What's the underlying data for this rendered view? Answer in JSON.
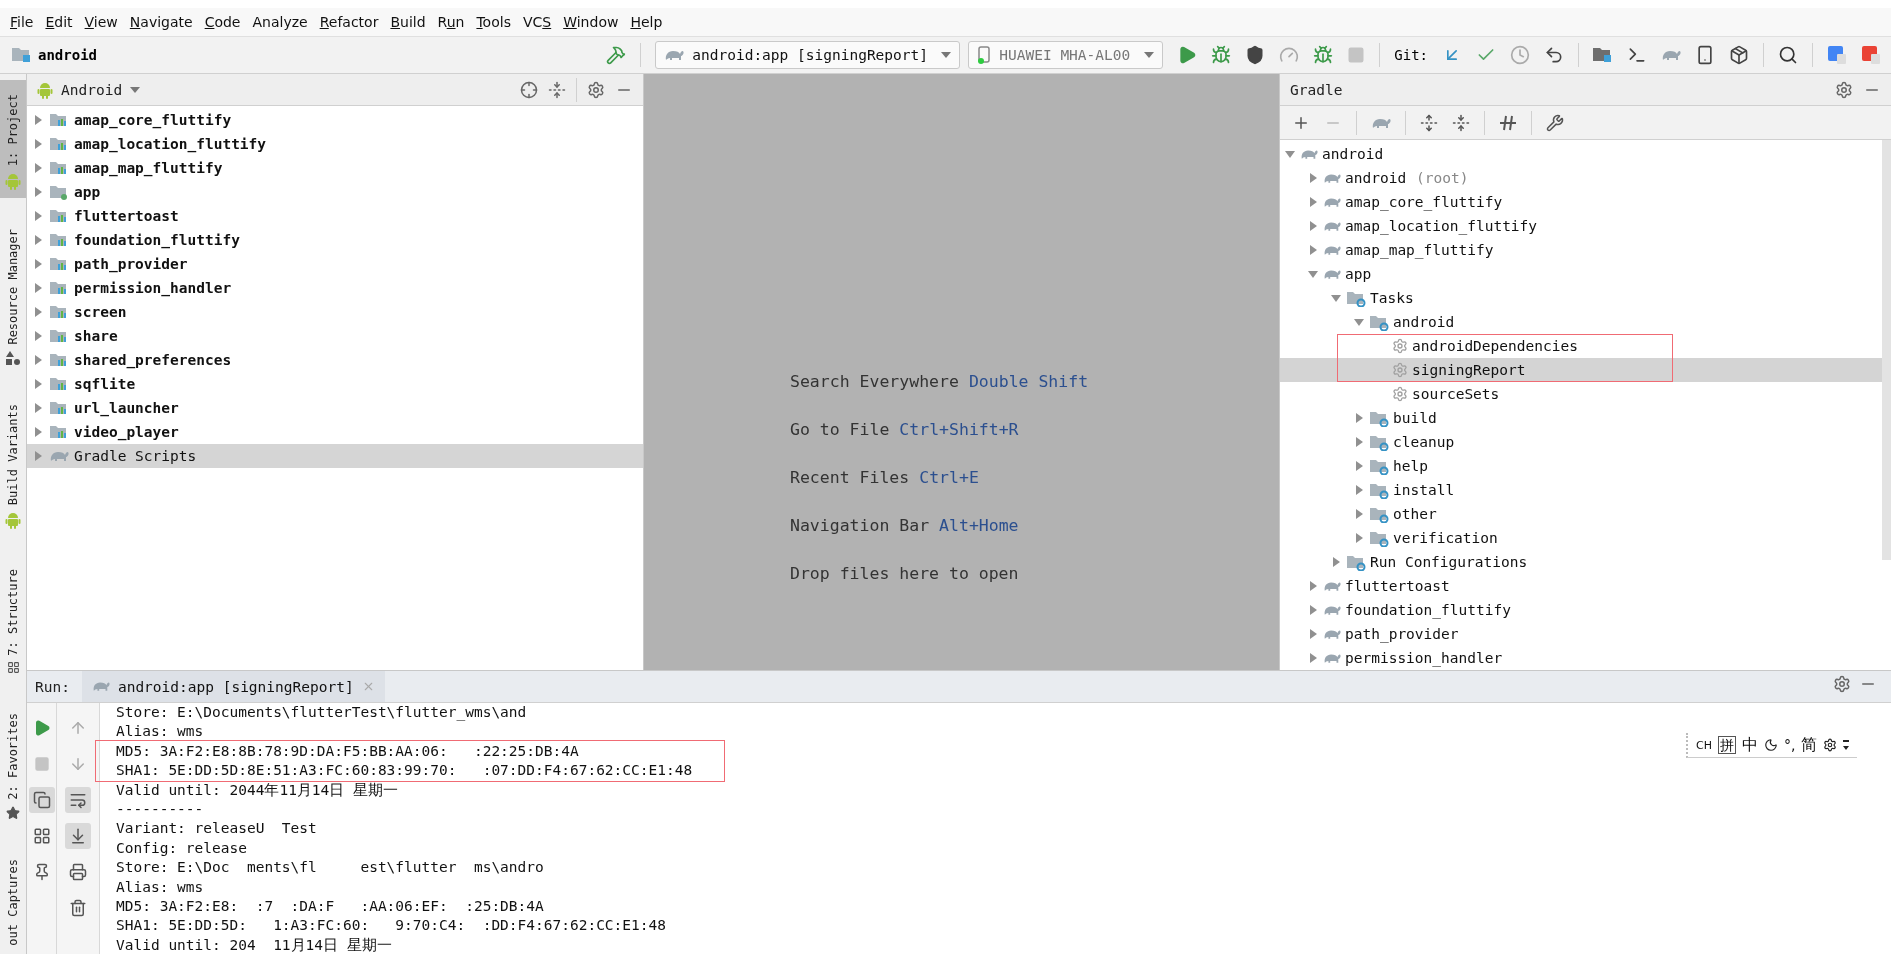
{
  "menu": [
    {
      "key": "F",
      "after": "ile"
    },
    {
      "key": "E",
      "after": "dit"
    },
    {
      "key": "V",
      "after": "iew"
    },
    {
      "key": "N",
      "after": "avigate"
    },
    {
      "key": "C",
      "after": "ode"
    },
    {
      "before": "Analyze"
    },
    {
      "key": "R",
      "after": "efactor"
    },
    {
      "key": "B",
      "after": "uild"
    },
    {
      "before": "R",
      "key": "u",
      "after": "n"
    },
    {
      "key": "T",
      "after": "ools"
    },
    {
      "before": "VC",
      "key": "S"
    },
    {
      "key": "W",
      "after": "indow"
    },
    {
      "key": "H",
      "after": "elp"
    }
  ],
  "toolbar": {
    "project": "android",
    "run_config": "android:app [signingReport]",
    "device": "HUAWEI MHA-AL00",
    "git_label": "Git:"
  },
  "tool_windows_left": [
    {
      "label": "1: Project",
      "selected": true,
      "kind": "android"
    },
    {
      "label": "Resource Manager",
      "selected": false,
      "kind": "shapes"
    },
    {
      "label": "Build Variants",
      "selected": false,
      "kind": "build"
    },
    {
      "label": "7: Structure",
      "selected": false,
      "kind": "structure"
    },
    {
      "label": "2: Favorites",
      "selected": false,
      "kind": "star"
    },
    {
      "label": "out Captures",
      "selected": false,
      "kind": "none"
    }
  ],
  "project_panel": {
    "view": "Android",
    "items": [
      {
        "label": "amap_core_fluttify",
        "kind": "module",
        "expanded": false,
        "selected": false
      },
      {
        "label": "amap_location_fluttify",
        "kind": "module",
        "expanded": false,
        "selected": false
      },
      {
        "label": "amap_map_fluttify",
        "kind": "module",
        "expanded": false,
        "selected": false
      },
      {
        "label": "app",
        "kind": "app",
        "expanded": false,
        "selected": false
      },
      {
        "label": "fluttertoast",
        "kind": "module",
        "expanded": false,
        "selected": false
      },
      {
        "label": "foundation_fluttify",
        "kind": "module",
        "expanded": false,
        "selected": false
      },
      {
        "label": "path_provider",
        "kind": "module",
        "expanded": false,
        "selected": false
      },
      {
        "label": "permission_handler",
        "kind": "module",
        "expanded": false,
        "selected": false
      },
      {
        "label": "screen",
        "kind": "module",
        "expanded": false,
        "selected": false
      },
      {
        "label": "share",
        "kind": "module",
        "expanded": false,
        "selected": false
      },
      {
        "label": "shared_preferences",
        "kind": "module",
        "expanded": false,
        "selected": false
      },
      {
        "label": "sqflite",
        "kind": "module",
        "expanded": false,
        "selected": false
      },
      {
        "label": "url_launcher",
        "kind": "module",
        "expanded": false,
        "selected": false
      },
      {
        "label": "video_player",
        "kind": "module",
        "expanded": false,
        "selected": false
      },
      {
        "label": "Gradle Scripts",
        "kind": "gradle",
        "expanded": false,
        "selected": true
      }
    ]
  },
  "editor_hints": [
    {
      "label": "Search Everywhere",
      "shortcut": "Double Shift"
    },
    {
      "label": "Go to File",
      "shortcut": "Ctrl+Shift+R"
    },
    {
      "label": "Recent Files",
      "shortcut": "Ctrl+E"
    },
    {
      "label": "Navigation Bar",
      "shortcut": "Alt+Home"
    },
    {
      "label": "Drop files here to open"
    }
  ],
  "gradle_panel": {
    "title": "Gradle",
    "tree": [
      {
        "label": "android",
        "kind": "project",
        "expanded": true,
        "selected": false,
        "children": [
          {
            "label": "android",
            "note": "(root)",
            "kind": "project",
            "expanded": false,
            "selected": false
          },
          {
            "label": "amap_core_fluttify",
            "kind": "project",
            "expanded": false,
            "selected": false
          },
          {
            "label": "amap_location_fluttify",
            "kind": "project",
            "expanded": false,
            "selected": false
          },
          {
            "label": "amap_map_fluttify",
            "kind": "project",
            "expanded": false,
            "selected": false
          },
          {
            "label": "app",
            "kind": "project",
            "expanded": true,
            "selected": false,
            "children": [
              {
                "label": "Tasks",
                "kind": "folder",
                "expanded": true,
                "selected": false,
                "children": [
                  {
                    "label": "android",
                    "kind": "folder",
                    "expanded": true,
                    "selected": false,
                    "children": [
                      {
                        "label": "androidDependencies",
                        "kind": "task",
                        "selected": false
                      },
                      {
                        "label": "signingReport",
                        "kind": "task",
                        "selected": true
                      },
                      {
                        "label": "sourceSets",
                        "kind": "task",
                        "selected": false
                      }
                    ]
                  },
                  {
                    "label": "build",
                    "kind": "folder",
                    "expanded": false,
                    "selected": false
                  },
                  {
                    "label": "cleanup",
                    "kind": "folder",
                    "expanded": false,
                    "selected": false
                  },
                  {
                    "label": "help",
                    "kind": "folder",
                    "expanded": false,
                    "selected": false
                  },
                  {
                    "label": "install",
                    "kind": "folder",
                    "expanded": false,
                    "selected": false
                  },
                  {
                    "label": "other",
                    "kind": "folder",
                    "expanded": false,
                    "selected": false
                  },
                  {
                    "label": "verification",
                    "kind": "folder",
                    "expanded": false,
                    "selected": false
                  }
                ]
              },
              {
                "label": "Run Configurations",
                "kind": "folder",
                "expanded": false,
                "selected": false
              }
            ]
          },
          {
            "label": "fluttertoast",
            "kind": "project",
            "expanded": false,
            "selected": false
          },
          {
            "label": "foundation_fluttify",
            "kind": "project",
            "expanded": false,
            "selected": false
          },
          {
            "label": "path_provider",
            "kind": "project",
            "expanded": false,
            "selected": false
          },
          {
            "label": "permission_handler",
            "kind": "project",
            "expanded": false,
            "selected": false
          }
        ]
      }
    ]
  },
  "run_panel": {
    "label": "Run:",
    "tab": "android:app [signingReport]",
    "lines": [
      "Store: E:\\Documents\\flutterTest\\flutter_wms\\and",
      "Alias: wms",
      "MD5: 3A:F2:E8:8B:78:9D:DA:F5:BB:AA:06:   :22:25:DB:4A",
      "SHA1: 5E:DD:5D:8E:51:A3:FC:60:83:99:70:   :07:DD:F4:67:62:CC:E1:48",
      "Valid until: 2044年11月14日 星期一",
      "----------",
      "Variant: releaseU  Test",
      "Config: release",
      "Store: E:\\Doc  ments\\fl     est\\flutter  ms\\andro",
      "Alias: wms",
      "MD5: 3A:F2:E8:  :7  :DA:F   :AA:06:EF:  :25:DB:4A",
      "SHA1: 5E:DD:5D:   1:A3:FC:60:   9:70:C4:  :DD:F4:67:62:CC:E1:48",
      "Valid until: 204  11月14日 星期一"
    ]
  },
  "input_method_bar": {
    "language": "CH",
    "mode": "拼",
    "script": "中",
    "punctuation": "°,",
    "charset": "简"
  }
}
